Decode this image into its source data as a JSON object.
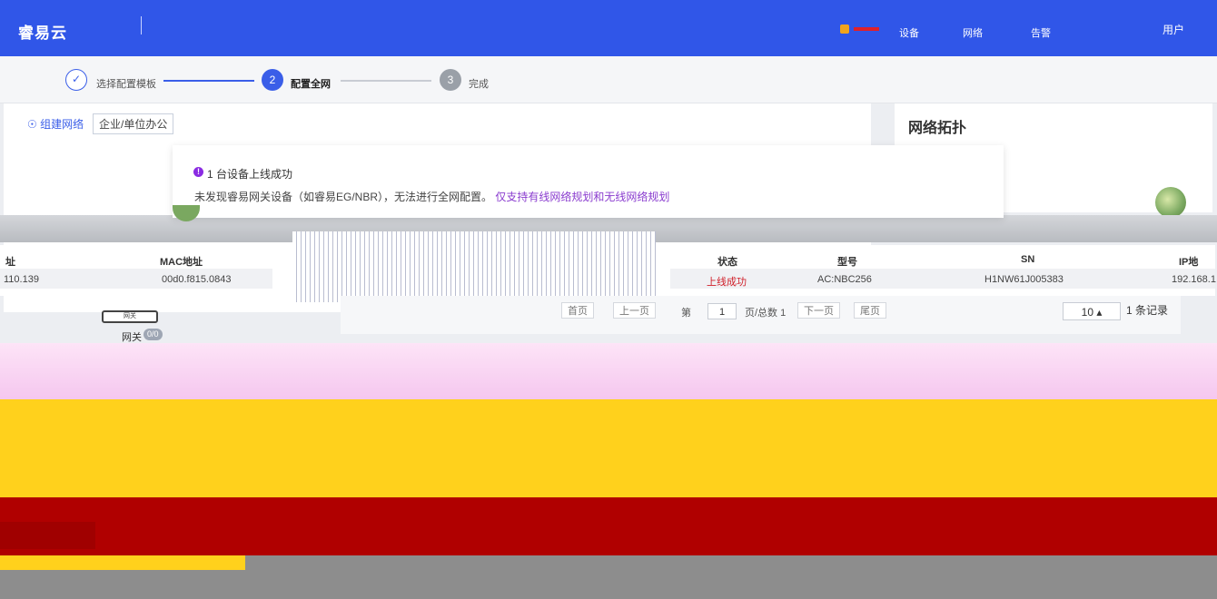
{
  "header": {
    "brand": "睿易云",
    "menu_items": [
      "设备",
      "网络",
      "告警"
    ],
    "user": "用户"
  },
  "stepper": {
    "steps": [
      {
        "label": "选择配置模板",
        "number": "✓",
        "state": "done"
      },
      {
        "label": "配置全网",
        "number": "2",
        "state": "active"
      },
      {
        "label": "完成",
        "number": "3",
        "state": "todo"
      }
    ]
  },
  "left_panel": {
    "tab_active": "组建网络",
    "tab_other": "企业/单位办公"
  },
  "right_panel": {
    "title": "网络拓扑"
  },
  "notice": {
    "title": "1 台设备上线成功",
    "message": "未发现睿易网关设备（如睿易EG/NBR），无法进行全网配置。",
    "link": "仅支持有线网络规划和无线网络规划"
  },
  "table": {
    "left_headers": [
      "址",
      "MAC地址"
    ],
    "left_row": [
      "110.139",
      "00d0.f815.0843"
    ],
    "right_headers": [
      "状态",
      "型号",
      "SN",
      "IP地"
    ],
    "right_row": [
      "上线成功",
      "AC:NBC256",
      "H1NW61J005383",
      "192.168.1"
    ]
  },
  "pagination": {
    "first": "首页",
    "prev": "上一页",
    "page_prefix": "第",
    "page_value": "1",
    "page_suffix": "页/总数 1",
    "next": "下一页",
    "last": "尾页",
    "page_size": "10 ▴",
    "records": "1 条记录"
  },
  "topology": {
    "device_tag": "网关",
    "device_label": "网关",
    "device_count": "0/0"
  },
  "colors": {
    "primary": "#3a5ee8",
    "header_bg": "#3056e8",
    "success_text": "#d0202a",
    "link": "#8a3ccf"
  }
}
